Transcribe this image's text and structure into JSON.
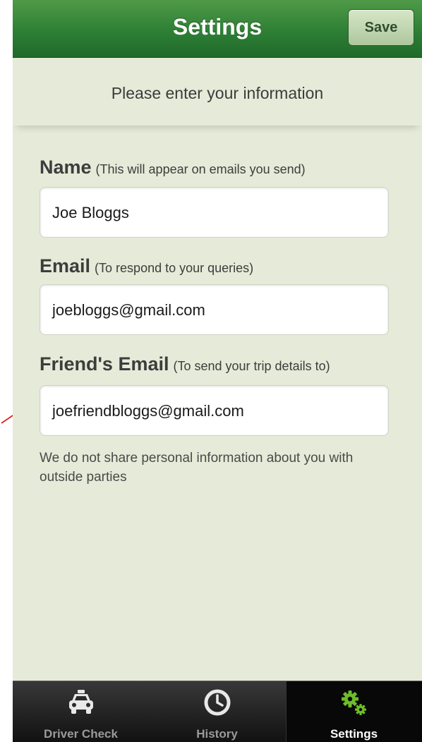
{
  "navbar": {
    "title": "Settings",
    "save_label": "Save"
  },
  "header": {
    "text": "Please enter your information"
  },
  "fields": [
    {
      "label": "Name",
      "hint": "(This will appear on emails you send)",
      "value": "Joe Bloggs"
    },
    {
      "label": "Email",
      "hint": "(To respond to your queries)",
      "value": "joebloggs@gmail.com"
    },
    {
      "label": "Friend's Email",
      "hint": "(To send your trip details to)",
      "value": "joefriendbloggs@gmail.com"
    }
  ],
  "privacy_note": "We do not share personal information about you with outside parties",
  "tabs": [
    {
      "label": "Driver Check",
      "icon": "taxi-icon",
      "active": false
    },
    {
      "label": "History",
      "icon": "clock-icon",
      "active": false
    },
    {
      "label": "Settings",
      "icon": "gears-icon",
      "active": true
    }
  ],
  "colors": {
    "navbar_green": "#2e7f35",
    "background": "#e6ead8",
    "annotation_arrow": "#e02020",
    "active_icon_green": "#6dbb2a"
  }
}
